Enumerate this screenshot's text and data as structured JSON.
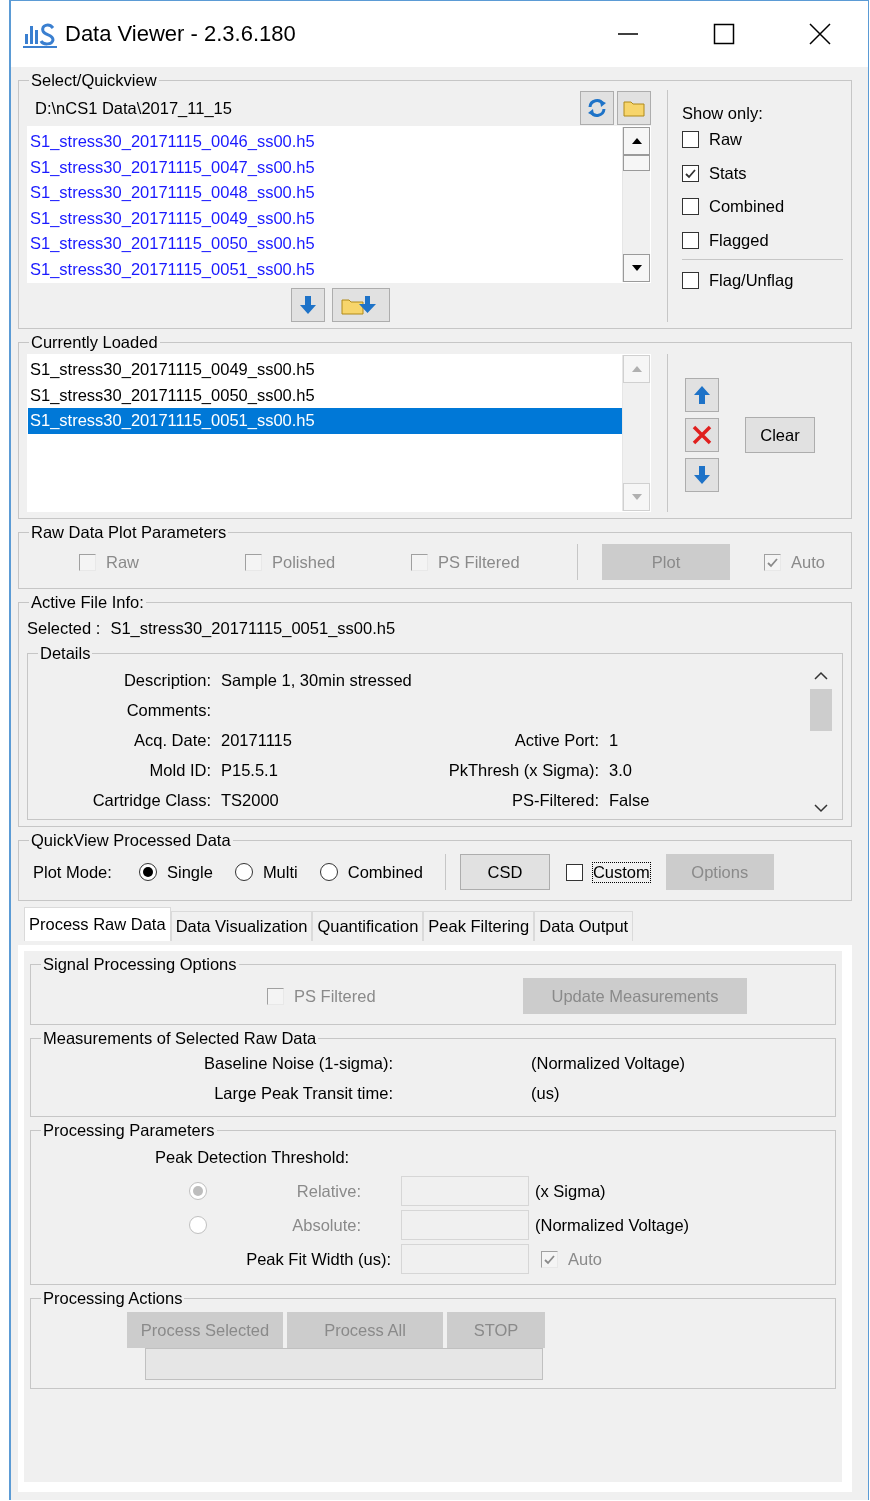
{
  "window": {
    "title": "Data Viewer - 2.3.6.180"
  },
  "select_quickview": {
    "title": "Select/Quickview",
    "path": "D:\\nCS1 Data\\2017_11_15",
    "files": [
      {
        "name": "S1_stress30_20171115_0046_ss00.h5",
        "selected": false
      },
      {
        "name": "S1_stress30_20171115_0047_ss00.h5",
        "selected": false
      },
      {
        "name": "S1_stress30_20171115_0048_ss00.h5",
        "selected": false
      },
      {
        "name": "S1_stress30_20171115_0049_ss00.h5",
        "selected": false
      },
      {
        "name": "S1_stress30_20171115_0050_ss00.h5",
        "selected": false
      },
      {
        "name": "S1_stress30_20171115_0051_ss00.h5",
        "selected": false
      }
    ],
    "show_only_label": "Show only:",
    "show_only": [
      {
        "label": "Raw",
        "checked": false
      },
      {
        "label": "Stats",
        "checked": true
      },
      {
        "label": "Combined",
        "checked": false
      },
      {
        "label": "Flagged",
        "checked": false
      }
    ],
    "flag_unflag": {
      "label": "Flag/Unflag",
      "checked": false
    }
  },
  "currently_loaded": {
    "title": "Currently Loaded",
    "files": [
      {
        "name": "S1_stress30_20171115_0049_ss00.h5",
        "selected": false
      },
      {
        "name": "S1_stress30_20171115_0050_ss00.h5",
        "selected": false
      },
      {
        "name": "S1_stress30_20171115_0051_ss00.h5",
        "selected": true
      }
    ],
    "clear_button": "Clear"
  },
  "raw_data_plot": {
    "title": "Raw Data Plot Parameters",
    "options": [
      {
        "label": "Raw",
        "checked": false,
        "disabled": true
      },
      {
        "label": "Polished",
        "checked": false,
        "disabled": true
      },
      {
        "label": "PS Filtered",
        "checked": false,
        "disabled": true
      }
    ],
    "plot_button": {
      "label": "Plot",
      "disabled": true
    },
    "auto": {
      "label": "Auto",
      "checked": true,
      "disabled": true
    }
  },
  "active_file_info": {
    "title": "Active File Info:",
    "selected_label": "Selected :",
    "selected_value": "S1_stress30_20171115_0051_ss00.h5",
    "details_title": "Details",
    "rows": [
      {
        "label": "Description:",
        "value": "Sample 1, 30min stressed"
      },
      {
        "label": "Comments:"
      },
      {
        "label": "Acq. Date:",
        "value": "20171115",
        "label_2": "Active Port:",
        "value_2": "1"
      },
      {
        "label": "Mold ID:",
        "value": "P15.5.1",
        "label_2": "PkThresh (x Sigma):",
        "value_2": "3.0"
      },
      {
        "label": "Cartridge Class:",
        "value": "TS2000",
        "label_2": "PS-Filtered:",
        "value_2": "False"
      }
    ]
  },
  "quickview": {
    "title": "QuickView Processed Data",
    "plot_mode_label": "Plot Mode:",
    "modes": [
      {
        "label": "Single",
        "selected": true
      },
      {
        "label": "Multi",
        "selected": false
      },
      {
        "label": "Combined",
        "selected": false
      }
    ],
    "csd_button": "CSD",
    "custom": {
      "label": "Custom",
      "checked": false
    },
    "options_button": {
      "label": "Options",
      "disabled": true
    }
  },
  "tabs": [
    {
      "label": "Process Raw Data",
      "selected": true
    },
    {
      "label": "Data Visualization",
      "selected": false
    },
    {
      "label": "Quantification",
      "selected": false
    },
    {
      "label": "Peak Filtering",
      "selected": false
    },
    {
      "label": "Data Output",
      "selected": false
    }
  ],
  "signal_processing": {
    "title": "Signal Processing Options",
    "ps_filtered": {
      "label": "PS Filtered",
      "checked": false,
      "disabled": true
    },
    "update_button": {
      "label": "Update Measurements",
      "disabled": true
    }
  },
  "measurements": {
    "title": "Measurements of Selected Raw Data",
    "rows": [
      {
        "label": "Baseline Noise (1-sigma):",
        "unit": "(Normalized Voltage)"
      },
      {
        "label": "Large Peak Transit time:",
        "unit": "(us)"
      }
    ]
  },
  "processing_parameters": {
    "title": "Processing Parameters",
    "threshold_label": "Peak Detection Threshold:",
    "thresholds": [
      {
        "label": "Relative:",
        "unit": "(x Sigma)",
        "selected": true,
        "disabled": true
      },
      {
        "label": "Absolute:",
        "unit": "(Normalized Voltage)",
        "selected": false,
        "disabled": true
      }
    ],
    "fit_width_label": "Peak Fit Width (us):",
    "fit_auto": {
      "label": "Auto",
      "checked": true,
      "disabled": true
    }
  },
  "processing_actions": {
    "title": "Processing Actions",
    "buttons": [
      {
        "label": "Process Selected",
        "disabled": true
      },
      {
        "label": "Process All",
        "disabled": true
      },
      {
        "label": "STOP",
        "disabled": true
      }
    ],
    "progress": {
      "level": 0
    }
  }
}
